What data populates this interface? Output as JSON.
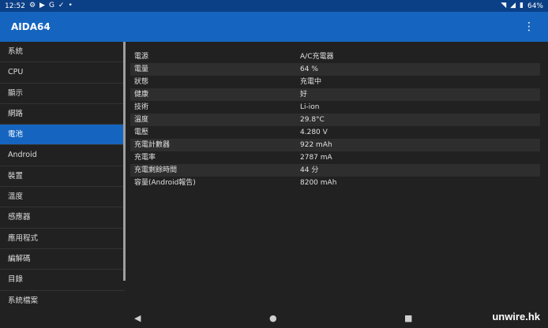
{
  "status_bar": {
    "time": "12:52",
    "left_icons": [
      "gear-icon",
      "youtube-icon",
      "google-icon",
      "check-icon",
      "dot-icon"
    ],
    "battery": "64%"
  },
  "app_bar": {
    "title": "AIDA64"
  },
  "sidebar": {
    "items": [
      {
        "label": "系統"
      },
      {
        "label": "CPU"
      },
      {
        "label": "顯示"
      },
      {
        "label": "網路"
      },
      {
        "label": "電池",
        "active": true
      },
      {
        "label": "Android"
      },
      {
        "label": "裝置"
      },
      {
        "label": "溫度"
      },
      {
        "label": "感應器"
      },
      {
        "label": "應用程式"
      },
      {
        "label": "編解碼"
      },
      {
        "label": "目錄"
      },
      {
        "label": "系統檔案"
      }
    ]
  },
  "battery_info": [
    {
      "label": "電源",
      "value": "A/C充電器"
    },
    {
      "label": "電量",
      "value": "64 %"
    },
    {
      "label": "狀態",
      "value": "充電中"
    },
    {
      "label": "健康",
      "value": "好"
    },
    {
      "label": "技術",
      "value": "Li-ion"
    },
    {
      "label": "溫度",
      "value": "29.8°C"
    },
    {
      "label": "電壓",
      "value": "4.280 V"
    },
    {
      "label": "充電計數器",
      "value": "922 mAh"
    },
    {
      "label": "充電率",
      "value": "2787 mA"
    },
    {
      "label": "充電剩餘時間",
      "value": "44 分"
    },
    {
      "label": "容量(Android報告)",
      "value": "8200 mAh"
    }
  ],
  "watermark": "unwire.hk",
  "colors": {
    "accent": "#1565c0",
    "status_bar": "#0b3f86",
    "background": "#212121"
  }
}
